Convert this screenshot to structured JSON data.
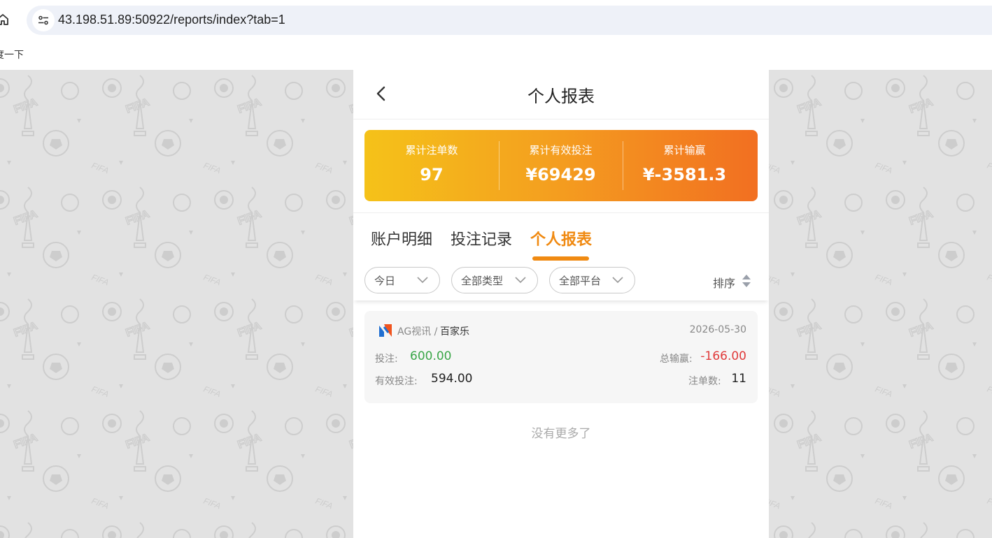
{
  "browser": {
    "url": "43.198.51.89:50922/reports/index?tab=1",
    "bookmark_label": "度一下"
  },
  "header": {
    "title": "个人报表"
  },
  "summary": {
    "bets_label": "累计注单数",
    "bets_value": "97",
    "valid_label": "累计有效投注",
    "valid_value": "¥69429",
    "winloss_label": "累计输赢",
    "winloss_value": "¥-3581.3"
  },
  "tabs": [
    {
      "label": "账户明细",
      "active": false
    },
    {
      "label": "投注记录",
      "active": false
    },
    {
      "label": "个人报表",
      "active": true
    }
  ],
  "filters": {
    "date": "今日",
    "type": "全部类型",
    "platform": "全部平台",
    "sort": "排序"
  },
  "record": {
    "provider": "AG视讯 /",
    "game": "百家乐",
    "date": "2026-05-30",
    "bet_label": "投注:",
    "bet_value": "600.00",
    "total_label": "总输赢:",
    "total_value": "-166.00",
    "valid_label": "有效投注:",
    "valid_value": "594.00",
    "count_label": "注单数:",
    "count_value": "11"
  },
  "list_end": "没有更多了",
  "colors": {
    "accent": "#f08a12",
    "positive": "#3aa648",
    "negative": "#e03a3a"
  }
}
